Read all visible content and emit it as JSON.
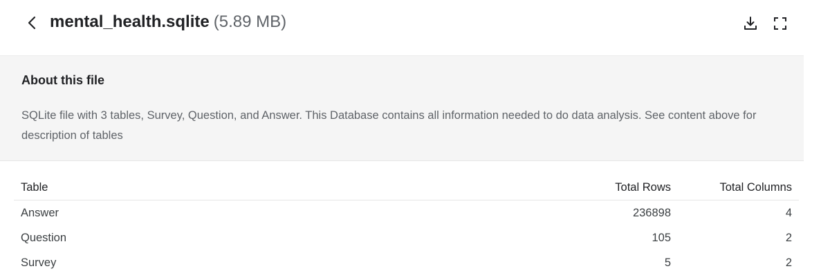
{
  "header": {
    "file_name": "mental_health.sqlite",
    "file_size": "(5.89 MB)"
  },
  "about": {
    "title": "About this file",
    "description": "SQLite file with 3 tables, Survey, Question, and Answer. This Database contains all information needed to do data analysis. See content above for description of tables"
  },
  "table": {
    "columns": [
      "Table",
      "Total Rows",
      "Total Columns"
    ],
    "rows": [
      {
        "name": "Answer",
        "rows": "236898",
        "columns": "4"
      },
      {
        "name": "Question",
        "rows": "105",
        "columns": "2"
      },
      {
        "name": "Survey",
        "rows": "5",
        "columns": "2"
      }
    ]
  },
  "icons": {
    "back": "chevron-left-icon",
    "download": "download-icon",
    "expand": "fullscreen-icon"
  },
  "colors": {
    "about_bg": "#f5f5f5",
    "text_primary": "#202124",
    "text_secondary": "#5f6368"
  }
}
